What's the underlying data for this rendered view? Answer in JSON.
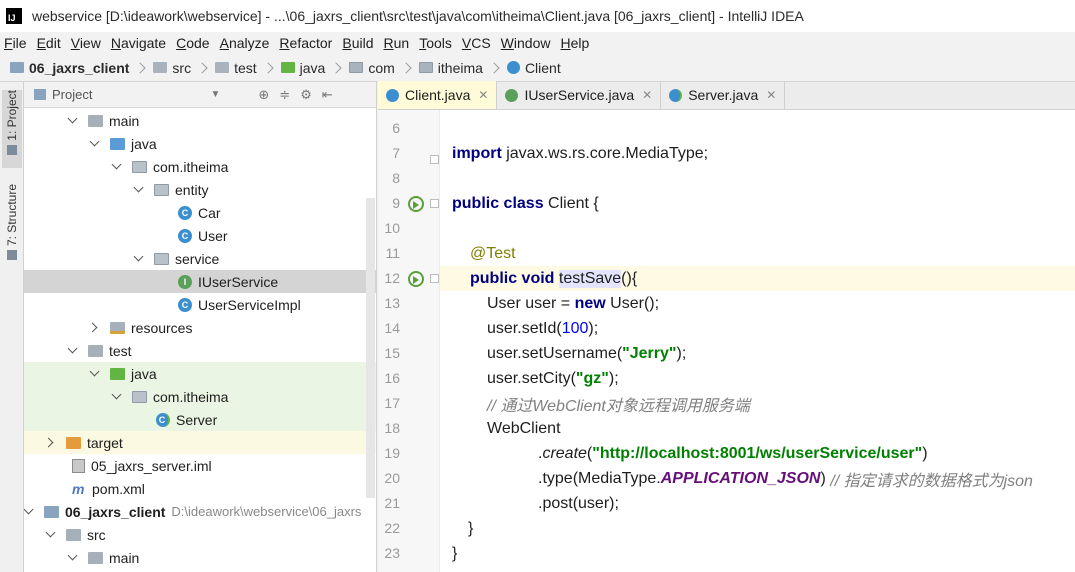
{
  "window": {
    "title": "webservice [D:\\ideawork\\webservice] - ...\\06_jaxrs_client\\src\\test\\java\\com\\itheima\\Client.java [06_jaxrs_client] - IntelliJ IDEA"
  },
  "menu": [
    "File",
    "Edit",
    "View",
    "Navigate",
    "Code",
    "Analyze",
    "Refactor",
    "Build",
    "Run",
    "Tools",
    "VCS",
    "Window",
    "Help"
  ],
  "breadcrumbs": [
    "06_jaxrs_client",
    "src",
    "test",
    "java",
    "com",
    "itheima",
    "Client"
  ],
  "left_tabs": {
    "project": "1: Project",
    "structure": "7: Structure"
  },
  "project_panel": {
    "title": "Project"
  },
  "tree": {
    "main": "main",
    "java": "java",
    "com_itheima": "com.itheima",
    "entity": "entity",
    "car": "Car",
    "user": "User",
    "service": "service",
    "iuserservice": "IUserService",
    "userserviceimpl": "UserServiceImpl",
    "resources": "resources",
    "test": "test",
    "test_java": "java",
    "test_com_itheima": "com.itheima",
    "server": "Server",
    "target": "target",
    "server_iml": "05_jaxrs_server.iml",
    "pom": "pom.xml",
    "client_module": "06_jaxrs_client",
    "client_module_path": "D:\\ideawork\\webservice\\06_jaxrs",
    "src": "src",
    "src_main": "main"
  },
  "tabs": [
    {
      "label": "Client.java",
      "active": true
    },
    {
      "label": "IUserService.java",
      "active": false
    },
    {
      "label": "Server.java",
      "active": false
    }
  ],
  "code": {
    "line_numbers": [
      "6",
      "7",
      "8",
      "9",
      "10",
      "11",
      "12",
      "13",
      "14",
      "15",
      "16",
      "17",
      "18",
      "19",
      "20",
      "21",
      "22",
      "23"
    ],
    "l7_kw": "import",
    "l7_rest": " javax.ws.rs.core.MediaType;",
    "l9_kw": "public class",
    "l9_rest": " Client {",
    "l11_annotation": "@Test",
    "l12_kw": "public void",
    "l12_method": "testSave",
    "l12_rest": "(){",
    "l13_a": "User user = ",
    "l13_kw": "new",
    "l13_b": " User();",
    "l14_a": "user.setId(",
    "l14_num": "100",
    "l14_b": ");",
    "l15_a": "user.setUsername(",
    "l15_str": "\"Jerry\"",
    "l15_b": ");",
    "l16_a": "user.setCity(",
    "l16_str": "\"gz\"",
    "l16_b": ");",
    "l17_comment": "// 通过WebClient对象远程调用服务端",
    "l18": "WebClient",
    "l19_a": ".",
    "l19_method": "create",
    "l19_b": "(",
    "l19_str": "\"http://localhost:8001/ws/userService/user\"",
    "l19_c": ")",
    "l20_a": ".type(MediaType.",
    "l20_static": "APPLICATION_JSON",
    "l20_b": ") ",
    "l20_comment": "// 指定请求的数据格式为json",
    "l21": ".post(user);",
    "l22": "}",
    "l23": "}"
  },
  "colors": {
    "keyword": "#000080",
    "string": "#008000",
    "number": "#0000ff",
    "comment": "#808080",
    "annotation": "#808000",
    "static_field": "#660e7a",
    "active_tab": "#fffbd8",
    "current_line": "#fffae3"
  }
}
